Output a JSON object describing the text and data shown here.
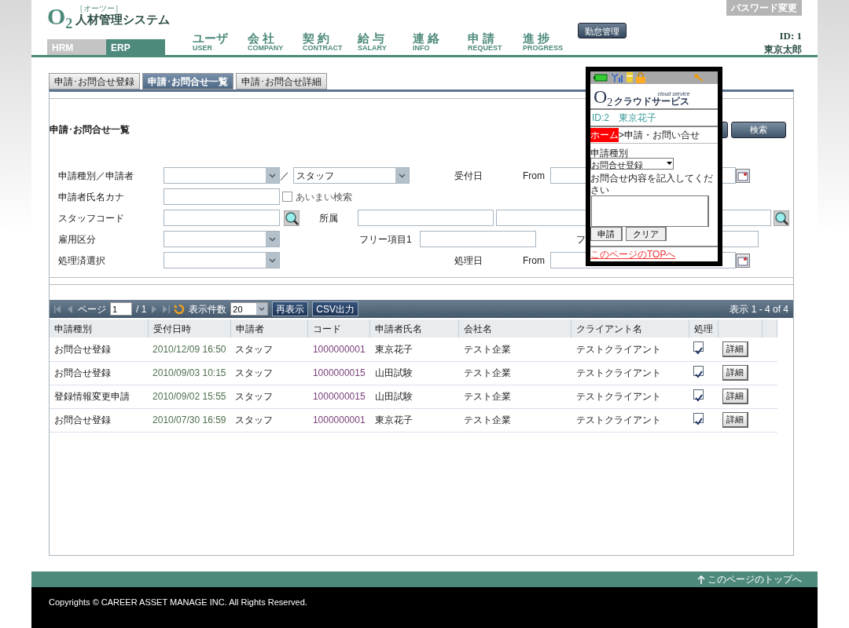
{
  "header": {
    "logo": {
      "mark": "O$_{2}$",
      "reading": "［オーツー］",
      "name": "人材管理システム"
    },
    "password_link": "パスワード変更",
    "system_tabs": [
      {
        "label": "HRM",
        "selected": false
      },
      {
        "label": "ERP",
        "selected": true
      }
    ],
    "nav": [
      {
        "label": "ユーザ",
        "sub": "USER"
      },
      {
        "label": "会 社",
        "sub": "COMPANY"
      },
      {
        "label": "契 約",
        "sub": "CONTRACT"
      },
      {
        "label": "給 与",
        "sub": "SALARY"
      },
      {
        "label": "連 絡",
        "sub": "INFO"
      },
      {
        "label": "申 請",
        "sub": "REQUEST"
      },
      {
        "label": "進 捗",
        "sub": "PROGRESS"
      }
    ],
    "attendance_button": "勤怠管理",
    "user_id": "ID: 1",
    "user_name": "東京太郎"
  },
  "tabs": [
    {
      "label": "申請･お問合せ登録",
      "selected": false
    },
    {
      "label": "申請･お問合せ一覧",
      "selected": true
    },
    {
      "label": "申請･お問合せ詳細",
      "selected": false
    }
  ],
  "panel": {
    "title": "申請･お問合せ一覧",
    "search_button": "検索"
  },
  "filters": [
    [
      {
        "kind": "label",
        "text": "申請種別／申請者"
      },
      {
        "kind": "select"
      },
      {
        "kind": "label",
        "text": "／"
      },
      {
        "kind": "select",
        "value": "スタッフ"
      },
      {
        "kind": "label",
        "text": "受付日"
      },
      {
        "kind": "label",
        "text": "From"
      },
      {
        "kind": "input"
      },
      {
        "kind": "calendar"
      }
    ],
    [
      {
        "kind": "label",
        "text": "申請者氏名カナ"
      },
      {
        "kind": "input"
      },
      {
        "kind": "checkbox",
        "text": "あいまい検索",
        "checked": false
      }
    ],
    [
      {
        "kind": "label",
        "text": "スタッフコード"
      },
      {
        "kind": "input"
      },
      {
        "kind": "lookup"
      },
      {
        "kind": "label",
        "text": "所属"
      },
      {
        "kind": "input"
      },
      {
        "kind": "input"
      },
      {
        "kind": "input"
      },
      {
        "kind": "lookup"
      }
    ],
    [
      {
        "kind": "label",
        "text": "雇用区分"
      },
      {
        "kind": "select"
      },
      {
        "kind": "label",
        "text": "フリー項目1"
      },
      {
        "kind": "input"
      },
      {
        "kind": "label",
        "text": "フ"
      },
      {
        "kind": "input"
      }
    ],
    [
      {
        "kind": "label",
        "text": "処理済選択"
      },
      {
        "kind": "select"
      },
      {
        "kind": "label",
        "text": "処理日"
      },
      {
        "kind": "label",
        "text": "From"
      },
      {
        "kind": "input"
      },
      {
        "kind": "calendar"
      }
    ]
  ],
  "grid": {
    "toolbar": {
      "page_label": "ページ",
      "page": "1",
      "page_total": "/ 1",
      "page_size_label": "表示件数",
      "page_size": "20",
      "buttons": [
        "再表示",
        "CSV出力"
      ],
      "summary": "表示 1 - 4 of 4"
    },
    "columns": [
      "申請種別",
      "受付日時",
      "申請者",
      "コード",
      "申請者氏名",
      "会社名",
      "クライアント名",
      "処理"
    ],
    "rows": [
      {
        "cells": [
          "お問合せ登録",
          "2010/12/09 16:50",
          "スタッフ",
          "1000000001",
          "東京花子",
          "テスト企業",
          "テストクライアント"
        ],
        "processed": true,
        "action": "詳細"
      },
      {
        "cells": [
          "お問合せ登録",
          "2010/09/03 10:15",
          "スタッフ",
          "1000000015",
          "山田試験",
          "テスト企業",
          "テストクライアント"
        ],
        "processed": true,
        "action": "詳細"
      },
      {
        "cells": [
          "登録情報変更申請",
          "2010/09/02 15:55",
          "スタッフ",
          "1000000015",
          "山田試験",
          "テスト企業",
          "テストクライアント"
        ],
        "processed": true,
        "action": "詳細"
      },
      {
        "cells": [
          "お問合せ登録",
          "2010/07/30 16:59",
          "スタッフ",
          "1000000001",
          "東京花子",
          "テスト企業",
          "テストクライアント"
        ],
        "processed": true,
        "action": "詳細"
      }
    ]
  },
  "phone": {
    "logo_mark": "O$_{2}$",
    "logo_name": "クラウドサービス",
    "logo_tagline": "cloud service",
    "user_id": "ID:2",
    "user_name": "東京花子",
    "home": "ホーム",
    "breadcrumb": ">申請・お問い合せ",
    "type_label": "申請種別",
    "type_value": "お問合せ登録",
    "message_label": "お問合せ内容を記入してください",
    "buttons": [
      "申請",
      "クリア"
    ],
    "top_link": "このページのTOPへ"
  },
  "footer": {
    "top_link": "このページのトップへ",
    "copyright": "Copyrights © CAREER ASSET MANAGE INC. All Rights Reserved."
  }
}
